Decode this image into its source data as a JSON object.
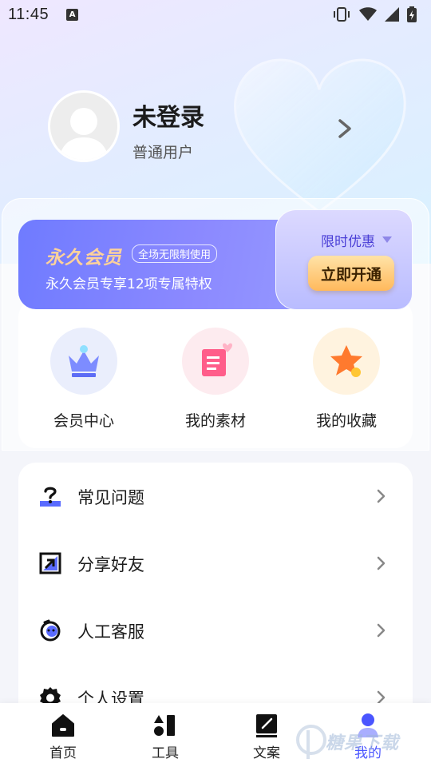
{
  "status_bar": {
    "time": "11:45",
    "notification_icon": "a-icon",
    "right_icons": [
      "vibrate-icon",
      "wifi-icon",
      "signal-icon",
      "battery-charging-icon"
    ]
  },
  "profile": {
    "name": "未登录",
    "level": "普通用户"
  },
  "vip": {
    "title": "永久会员",
    "tag": "全场无限制使用",
    "description": "永久会员专享12项专属特权",
    "limited": "限时优惠",
    "open_button": "立即开通"
  },
  "features": [
    {
      "label": "会员中心",
      "icon": "crown-icon"
    },
    {
      "label": "我的素材",
      "icon": "document-heart-icon"
    },
    {
      "label": "我的收藏",
      "icon": "star-icon"
    }
  ],
  "menu": [
    {
      "label": "常见问题",
      "icon": "question-icon"
    },
    {
      "label": "分享好友",
      "icon": "share-icon"
    },
    {
      "label": "人工客服",
      "icon": "service-icon"
    },
    {
      "label": "个人设置",
      "icon": "settings-gear-icon"
    }
  ],
  "bottom_nav": [
    {
      "label": "首页",
      "icon": "home-icon"
    },
    {
      "label": "工具",
      "icon": "tools-icon"
    },
    {
      "label": "文案",
      "icon": "edit-note-icon"
    },
    {
      "label": "我的",
      "icon": "profile-icon",
      "active": true
    }
  ],
  "watermark": "糖果下载",
  "colors": {
    "accent": "#4a55ff",
    "vip_gold": "#ffd29a",
    "button_gold": "#ffb95c"
  }
}
